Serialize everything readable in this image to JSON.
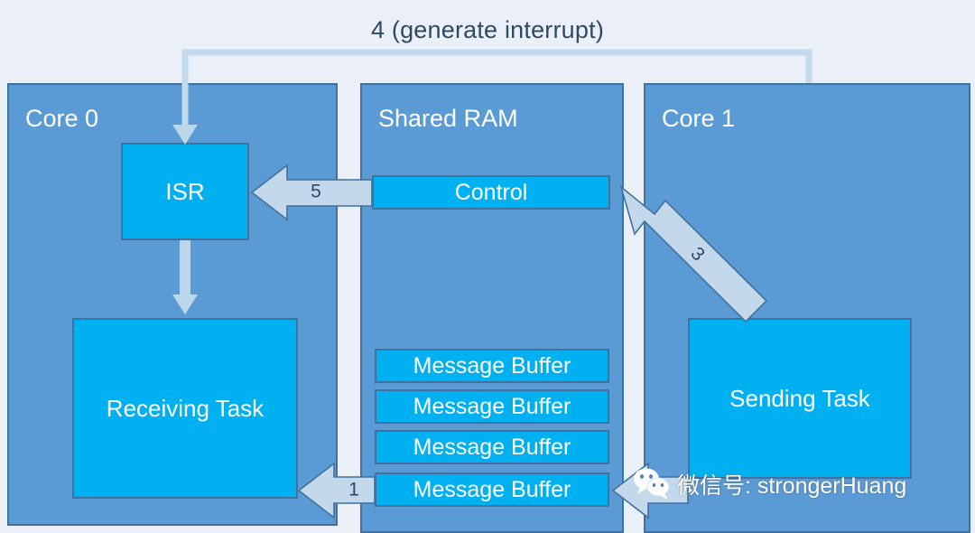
{
  "title": "4 (generate interrupt)",
  "panels": [
    {
      "id": "core0",
      "label": "Core 0"
    },
    {
      "id": "ram",
      "label": "Shared RAM"
    },
    {
      "id": "core1",
      "label": "Core 1"
    }
  ],
  "blocks": {
    "isr": "ISR",
    "receiving_task": "Receiving Task",
    "control": "Control",
    "sending_task": "Sending Task"
  },
  "message_buffers": [
    "Message Buffer",
    "Message Buffer",
    "Message Buffer",
    "Message Buffer"
  ],
  "arrows": [
    {
      "name": "interrupt-generate",
      "label": "4 (generate interrupt)",
      "from": "Core 1",
      "to": "ISR"
    },
    {
      "name": "control-to-isr",
      "label": "5",
      "from": "Control",
      "to": "ISR"
    },
    {
      "name": "sendtask-to-control",
      "label": "3",
      "from": "Sending Task",
      "to": "Control"
    },
    {
      "name": "msgbuf-to-recvtask",
      "label": "1",
      "from": "Message Buffer",
      "to": "Receiving Task"
    },
    {
      "name": "sendtask-to-msgbuf",
      "label": "",
      "from": "Sending Task",
      "to": "Message Buffer"
    },
    {
      "name": "isr-to-recvtask",
      "label": "",
      "from": "ISR",
      "to": "Receiving Task"
    }
  ],
  "watermark": {
    "icon": "wechat-icon",
    "text": "微信号: strongerHuang"
  },
  "colors": {
    "background": "#eaeff8",
    "panel_fill": "#5b9bd5",
    "panel_border": "#41719c",
    "block_fill": "#00b0f0",
    "arrow_fill": "#c3d8ea",
    "title_text": "#2f4a63",
    "block_text": "#ffffff"
  }
}
